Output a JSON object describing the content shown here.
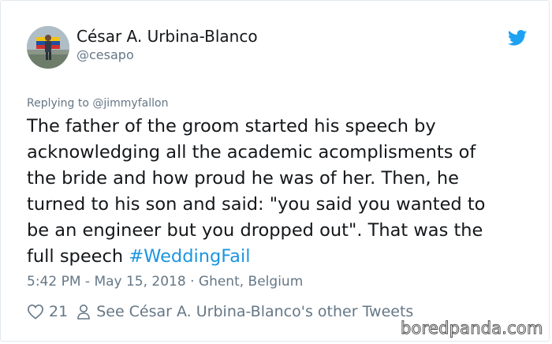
{
  "tweet": {
    "author": {
      "display_name": "César A. Urbina-Blanco",
      "handle": "@cesapo"
    },
    "replying_to": "Replying to @jimmyfallon",
    "text_lines": [
      "The father of the groom started his speech by",
      "acknowledging all the academic acomplisments of",
      "the bride and how proud he was of her. Then, he",
      "turned to his son and said: \"you said you wanted to",
      "be an engineer but you dropped out\". That was the"
    ],
    "last_line_text": "full speech ",
    "hashtag": "#WeddingFail",
    "timestamp_location": "5:42 PM - May 15, 2018 · Ghent, Belgium",
    "like_count": "21",
    "other_tweets_link": "See César A. Urbina-Blanco's other Tweets"
  },
  "icons": {
    "brand": "twitter-bird-icon",
    "like": "heart-icon",
    "profile": "person-icon"
  },
  "colors": {
    "twitter_blue": "#1da1f2",
    "hashtag": "#1b95e0",
    "secondary_text": "#657786",
    "primary_text": "#14171a"
  },
  "watermark": "boredpanda.com"
}
